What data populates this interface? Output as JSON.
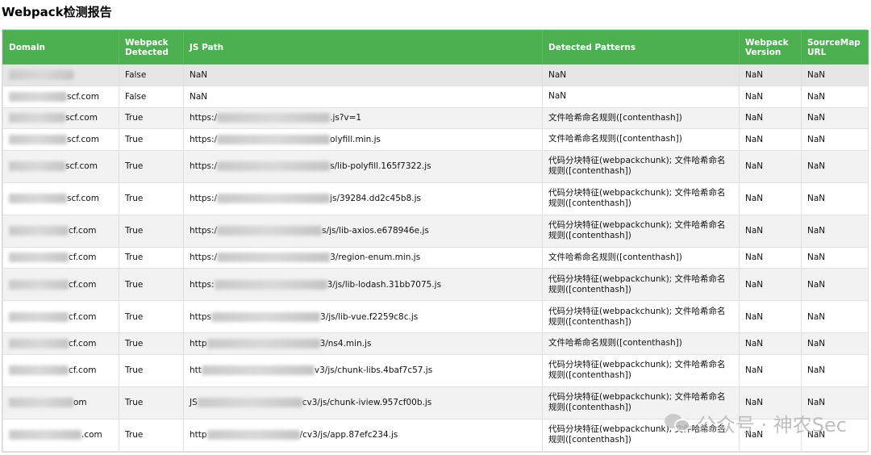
{
  "title": "Webpack检测报告",
  "header_color": "#4caf50",
  "columns": [
    "Domain",
    "Webpack Detected",
    "JS Path",
    "Detected Patterns",
    "Webpack Version",
    "SourceMap URL"
  ],
  "rows": [
    {
      "domain_suffix": "",
      "detected": "False",
      "path_prefix": "NaN",
      "path_suffix": "",
      "patterns": "NaN",
      "version": "NaN",
      "sourcemap": "NaN"
    },
    {
      "domain_suffix": "scf.com",
      "detected": "False",
      "path_prefix": "NaN",
      "path_suffix": "",
      "patterns": "NaN",
      "version": "NaN",
      "sourcemap": "NaN"
    },
    {
      "domain_suffix": "scf.com",
      "detected": "True",
      "path_prefix": "https:/",
      "path_suffix": ".js?v=1",
      "patterns": "文件哈希命名规则([contenthash])",
      "version": "NaN",
      "sourcemap": "NaN"
    },
    {
      "domain_suffix": "scf.com",
      "detected": "True",
      "path_prefix": "https:/",
      "path_suffix": "olyfill.min.js",
      "patterns": "文件哈希命名规则([contenthash])",
      "version": "NaN",
      "sourcemap": "NaN"
    },
    {
      "domain_suffix": "scf.com",
      "detected": "True",
      "path_prefix": "https:/",
      "path_suffix": "s/lib-polyfill.165f7322.js",
      "patterns": "代码分块特征(webpackchunk); 文件哈希命名规则([contenthash])",
      "version": "NaN",
      "sourcemap": "NaN"
    },
    {
      "domain_suffix": "scf.com",
      "detected": "True",
      "path_prefix": "https:/",
      "path_suffix": "js/39284.dd2c45b8.js",
      "patterns": "代码分块特征(webpackchunk); 文件哈希命名规则([contenthash])",
      "version": "NaN",
      "sourcemap": "NaN"
    },
    {
      "domain_suffix": "cf.com",
      "detected": "True",
      "path_prefix": "https:/",
      "path_suffix": "s/js/lib-axios.e678946e.js",
      "patterns": "代码分块特征(webpackchunk); 文件哈希命名规则([contenthash])",
      "version": "NaN",
      "sourcemap": "NaN"
    },
    {
      "domain_suffix": "cf.com",
      "detected": "True",
      "path_prefix": "https:/",
      "path_suffix": "3/region-enum.min.js",
      "patterns": "文件哈希命名规则([contenthash])",
      "version": "NaN",
      "sourcemap": "NaN"
    },
    {
      "domain_suffix": "cf.com",
      "detected": "True",
      "path_prefix": "https:",
      "path_suffix": "3/js/lib-lodash.31bb7075.js",
      "patterns": "代码分块特征(webpackchunk); 文件哈希命名规则([contenthash])",
      "version": "NaN",
      "sourcemap": "NaN"
    },
    {
      "domain_suffix": "cf.com",
      "detected": "True",
      "path_prefix": "https",
      "path_suffix": "3/js/lib-vue.f2259c8c.js",
      "patterns": "代码分块特征(webpackchunk); 文件哈希命名规则([contenthash])",
      "version": "NaN",
      "sourcemap": "NaN"
    },
    {
      "domain_suffix": "cf.com",
      "detected": "True",
      "path_prefix": "http",
      "path_suffix": "3/ns4.min.js",
      "patterns": "文件哈希命名规则([contenthash])",
      "version": "NaN",
      "sourcemap": "NaN"
    },
    {
      "domain_suffix": "cf.com",
      "detected": "True",
      "path_prefix": "htt",
      "path_suffix": "v3/js/chunk-libs.4baf7c57.js",
      "patterns": "代码分块特征(webpackchunk); 文件哈希命名规则([contenthash])",
      "version": "NaN",
      "sourcemap": "NaN"
    },
    {
      "domain_suffix": "om",
      "detected": "True",
      "path_prefix": "JS",
      "path_suffix": "cv3/js/chunk-iview.957cf00b.js",
      "patterns": "代码分块特征(webpackchunk); 文件哈希命名规则([contenthash])",
      "version": "NaN",
      "sourcemap": "NaN"
    },
    {
      "domain_suffix": ".com",
      "detected": "True",
      "path_prefix": "http",
      "path_suffix": "/cv3/js/app.87efc234.js",
      "patterns": "代码分块特征(webpackchunk); 文件哈希命名规则([contenthash])",
      "version": "NaN",
      "sourcemap": "NaN"
    }
  ],
  "watermark": {
    "text": "公众号 · 神农Sec",
    "icon": "wechat-icon"
  }
}
